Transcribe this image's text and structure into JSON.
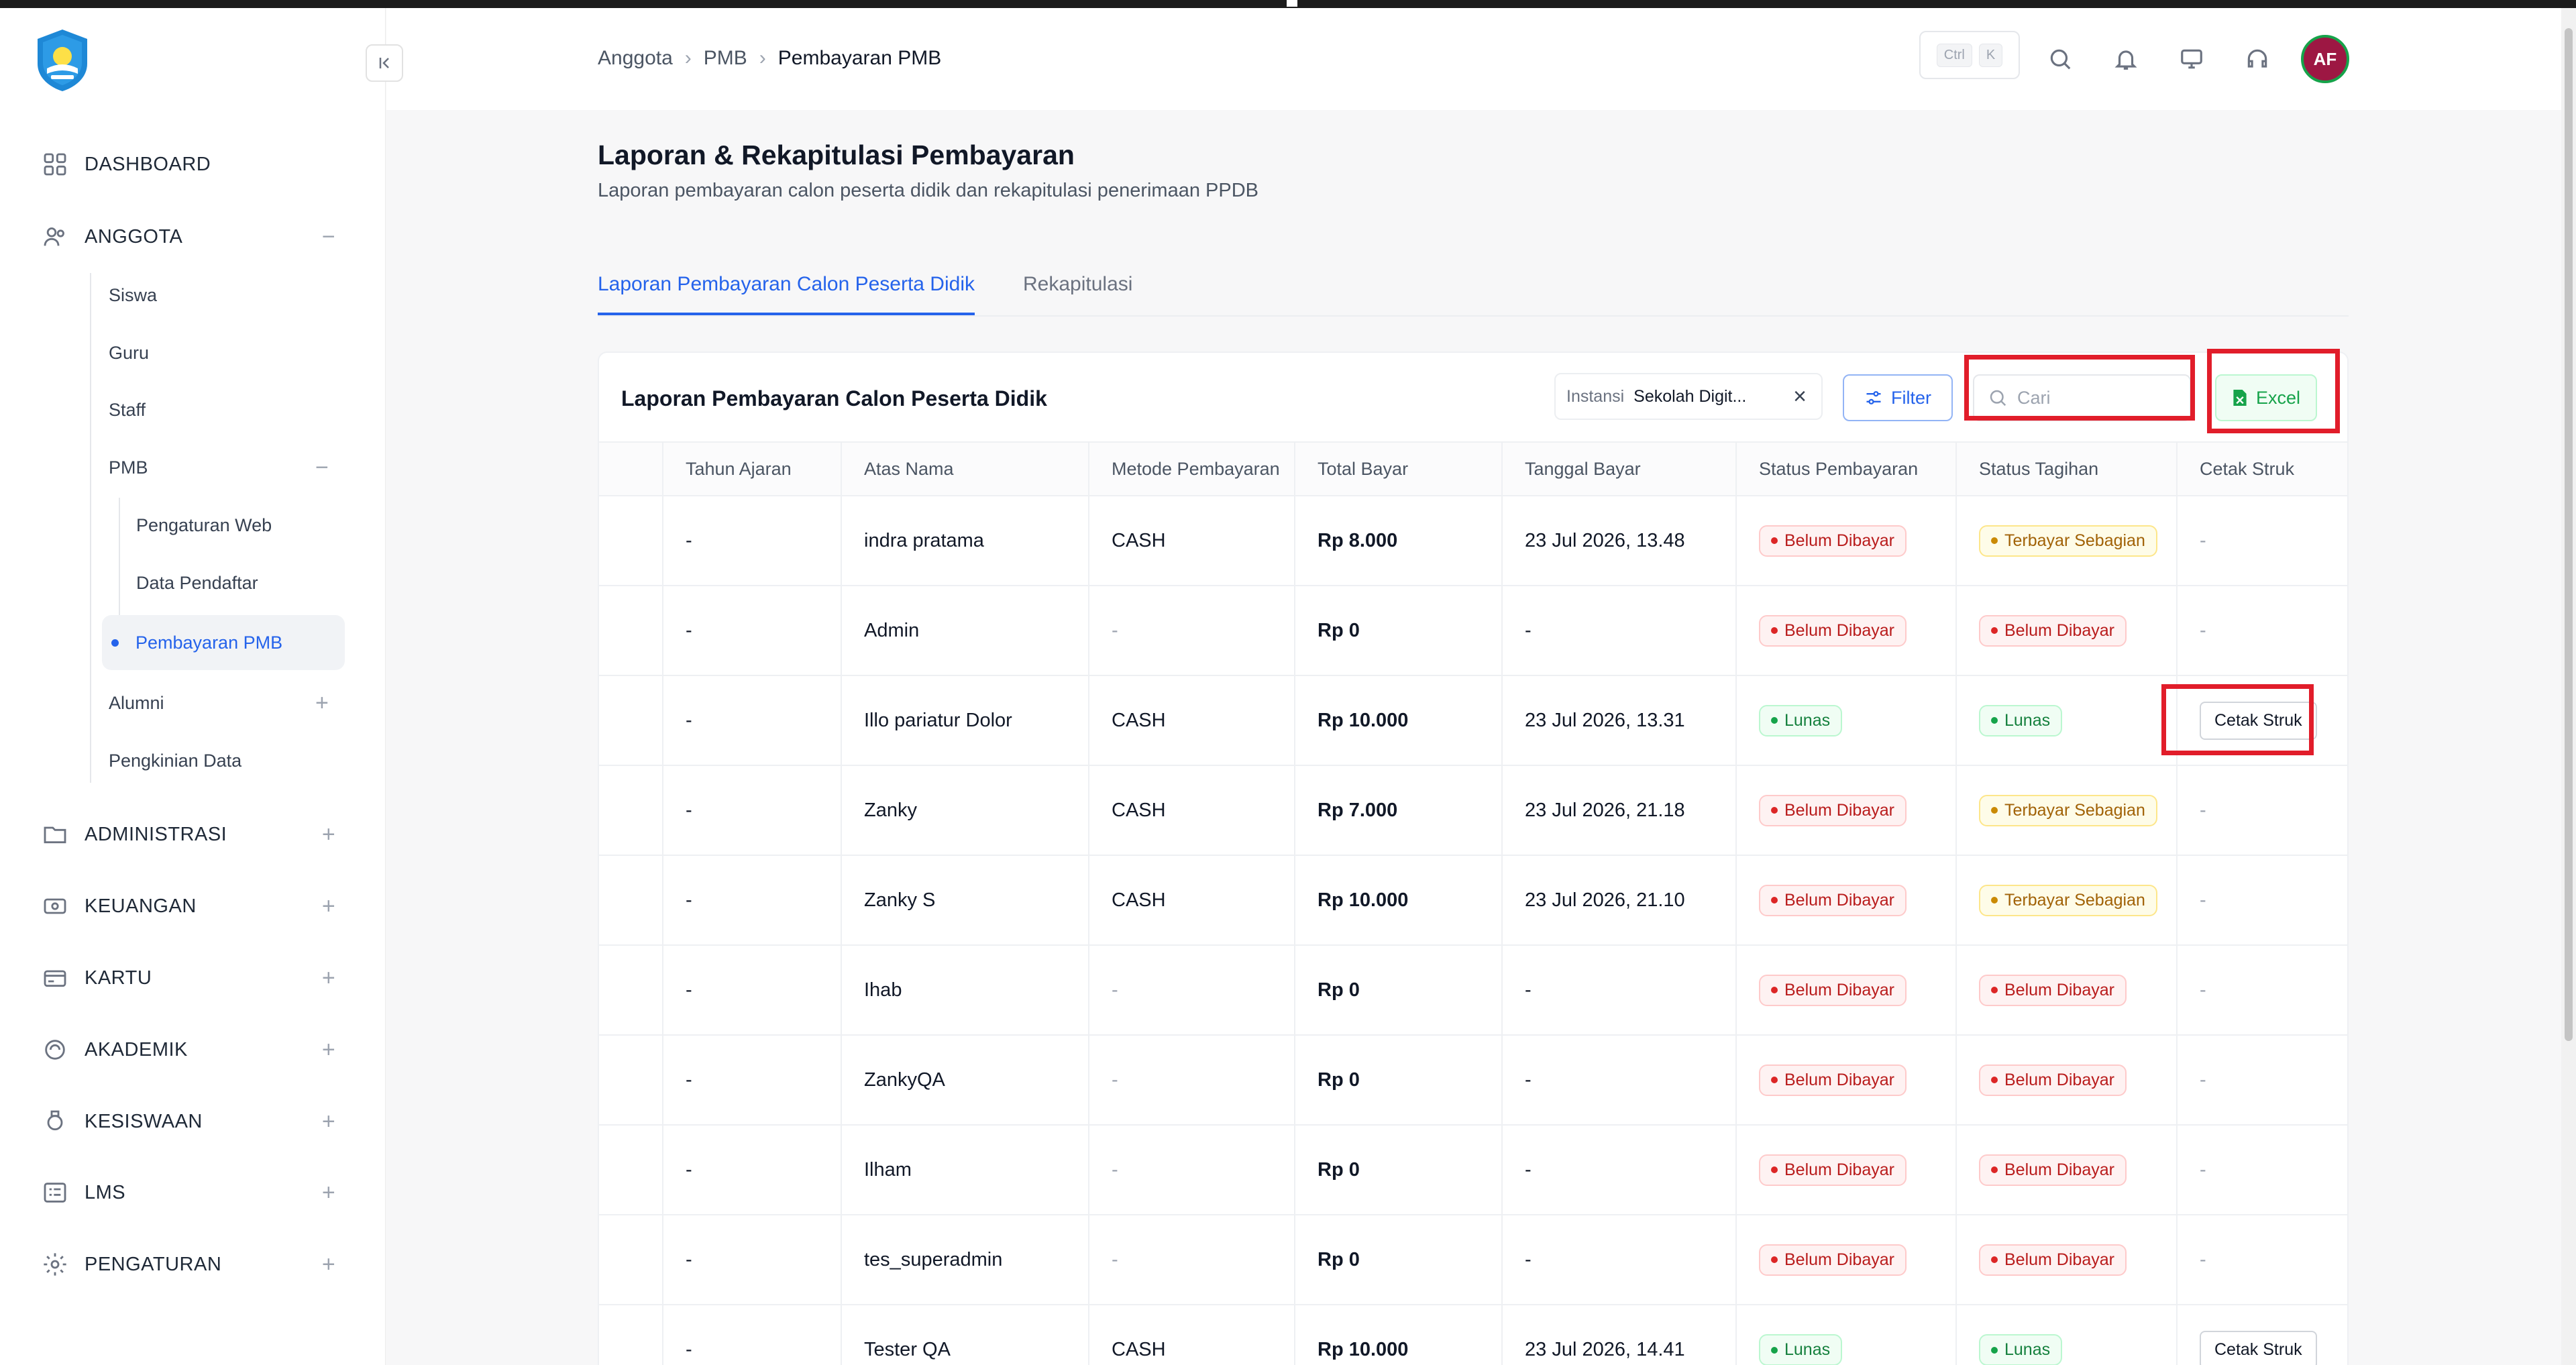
{
  "sidebar": {
    "items": [
      {
        "label": "DASHBOARD",
        "icon": "grid-icon"
      },
      {
        "label": "ANGGOTA",
        "icon": "users-icon",
        "toggle": "−"
      },
      {
        "label": "ADMINISTRASI",
        "icon": "folder-icon",
        "toggle": "+"
      },
      {
        "label": "KEUANGAN",
        "icon": "money-icon",
        "toggle": "+"
      },
      {
        "label": "KARTU",
        "icon": "card-icon",
        "toggle": "+"
      },
      {
        "label": "AKADEMIK",
        "icon": "academic-icon",
        "toggle": "+"
      },
      {
        "label": "KESISWAAN",
        "icon": "badge-icon",
        "toggle": "+"
      },
      {
        "label": "LMS",
        "icon": "list-icon",
        "toggle": "+"
      },
      {
        "label": "PENGATURAN",
        "icon": "gear-icon",
        "toggle": "+"
      }
    ],
    "anggota_sub": {
      "siswa": "Siswa",
      "guru": "Guru",
      "staff": "Staff",
      "pmb": "PMB",
      "pmb_toggle": "−",
      "pengaturan_web": "Pengaturan Web",
      "data_pendaftar": "Data Pendaftar",
      "pembayaran_pmb": "Pembayaran PMB",
      "alumni": "Alumni",
      "alumni_toggle": "+",
      "pengkinian_data": "Pengkinian Data"
    }
  },
  "topbar": {
    "breadcrumb": [
      "Anggota",
      "PMB",
      "Pembayaran PMB"
    ],
    "shortcut_keys": [
      "Ctrl",
      "K"
    ],
    "avatar_initials": "AF"
  },
  "page": {
    "title": "Laporan & Rekapitulasi Pembayaran",
    "subtitle": "Laporan pembayaran calon peserta didik dan rekapitulasi penerimaan PPDB",
    "tabs": [
      "Laporan Pembayaran Calon Peserta Didik",
      "Rekapitulasi"
    ]
  },
  "card": {
    "title": "Laporan Pembayaran Calon Peserta Didik",
    "instansi_label": "Instansi",
    "instansi_value": "Sekolah Digit...",
    "filter_label": "Filter",
    "search_placeholder": "Cari",
    "excel_label": "Excel"
  },
  "table": {
    "headers": [
      "Tahun Ajaran",
      "Atas Nama",
      "Metode Pembayaran",
      "Total Bayar",
      "Tanggal Bayar",
      "Status Pembayaran",
      "Status Tagihan",
      "Cetak Struk"
    ],
    "rows": [
      {
        "tahun": "-",
        "nama": "indra pratama",
        "metode": "CASH",
        "total": "Rp 8.000",
        "tanggal": "23 Jul 2026, 13.48",
        "status_bayar": "Belum Dibayar",
        "status_tagihan": "Terbayar Sebagian",
        "cetak": "-"
      },
      {
        "tahun": "-",
        "nama": "Admin",
        "metode": "-",
        "total": "Rp 0",
        "tanggal": "-",
        "status_bayar": "Belum Dibayar",
        "status_tagihan": "Belum Dibayar",
        "cetak": "-"
      },
      {
        "tahun": "-",
        "nama": "Illo pariatur Dolor",
        "metode": "CASH",
        "total": "Rp 10.000",
        "tanggal": "23 Jul 2026, 13.31",
        "status_bayar": "Lunas",
        "status_tagihan": "Lunas",
        "cetak": "Cetak Struk"
      },
      {
        "tahun": "-",
        "nama": "Zanky",
        "metode": "CASH",
        "total": "Rp 7.000",
        "tanggal": "23 Jul 2026, 21.18",
        "status_bayar": "Belum Dibayar",
        "status_tagihan": "Terbayar Sebagian",
        "cetak": "-"
      },
      {
        "tahun": "-",
        "nama": "Zanky S",
        "metode": "CASH",
        "total": "Rp 10.000",
        "tanggal": "23 Jul 2026, 21.10",
        "status_bayar": "Belum Dibayar",
        "status_tagihan": "Terbayar Sebagian",
        "cetak": "-"
      },
      {
        "tahun": "-",
        "nama": "Ihab",
        "metode": "-",
        "total": "Rp 0",
        "tanggal": "-",
        "status_bayar": "Belum Dibayar",
        "status_tagihan": "Belum Dibayar",
        "cetak": "-"
      },
      {
        "tahun": "-",
        "nama": "ZankyQA",
        "metode": "-",
        "total": "Rp 0",
        "tanggal": "-",
        "status_bayar": "Belum Dibayar",
        "status_tagihan": "Belum Dibayar",
        "cetak": "-"
      },
      {
        "tahun": "-",
        "nama": "Ilham",
        "metode": "-",
        "total": "Rp 0",
        "tanggal": "-",
        "status_bayar": "Belum Dibayar",
        "status_tagihan": "Belum Dibayar",
        "cetak": "-"
      },
      {
        "tahun": "-",
        "nama": "tes_superadmin",
        "metode": "-",
        "total": "Rp 0",
        "tanggal": "-",
        "status_bayar": "Belum Dibayar",
        "status_tagihan": "Belum Dibayar",
        "cetak": "-"
      },
      {
        "tahun": "-",
        "nama": "Tester QA",
        "metode": "CASH",
        "total": "Rp 10.000",
        "tanggal": "23 Jul 2026, 14.41",
        "status_bayar": "Lunas",
        "status_tagihan": "Lunas",
        "cetak": "Cetak Struk"
      }
    ]
  },
  "colors": {
    "accent": "#2563eb",
    "danger": "#dc2626",
    "success": "#16a34a",
    "warning": "#ca8a04",
    "highlight": "#e11d2a"
  }
}
